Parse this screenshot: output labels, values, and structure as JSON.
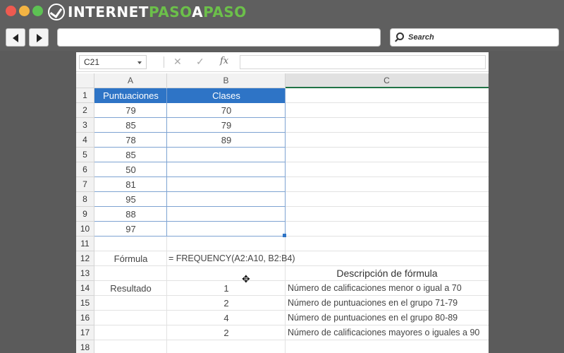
{
  "browser": {
    "logo": {
      "text_white_1": "INTERNET",
      "text_green": "PASO",
      "text_white_2": "A",
      "text_green_2": "PASO"
    },
    "search_label": "Search",
    "colors": {
      "chrome": "#5f5f5f",
      "close": "#ee5a50",
      "minimize": "#f3b443",
      "maximize": "#5dc253",
      "logo_accent": "#6cc04a"
    }
  },
  "formula_bar": {
    "name_box": "C21",
    "cancel_icon": "✕",
    "enter_icon": "✓",
    "fx_icon": "fx",
    "formula": ""
  },
  "columns": [
    "A",
    "B",
    "C"
  ],
  "rows": [
    "1",
    "2",
    "3",
    "4",
    "5",
    "6",
    "7",
    "8",
    "9",
    "10",
    "11",
    "12",
    "13",
    "14",
    "15",
    "16",
    "17",
    "18"
  ],
  "table": {
    "header_a": "Puntuaciones",
    "header_b": "Clases",
    "scores": [
      "79",
      "85",
      "78",
      "85",
      "50",
      "81",
      "95",
      "88",
      "97"
    ],
    "classes": [
      "70",
      "79",
      "89"
    ],
    "header_color": "#2e74c6"
  },
  "formula_row": {
    "label": "Fórmula",
    "formula": "= FREQUENCY(A2:A10, B2:B4)"
  },
  "description_header": "Descripción de fórmula",
  "results": {
    "label": "Resultado",
    "values": [
      "1",
      "2",
      "4",
      "2"
    ],
    "descriptions": [
      "Número de calificaciones menor o igual a 70",
      "Número de puntuaciones en el grupo 71-79",
      "Número de puntuaciones en el grupo 80-89",
      "Número de calificaciones mayores o iguales a 90"
    ]
  }
}
